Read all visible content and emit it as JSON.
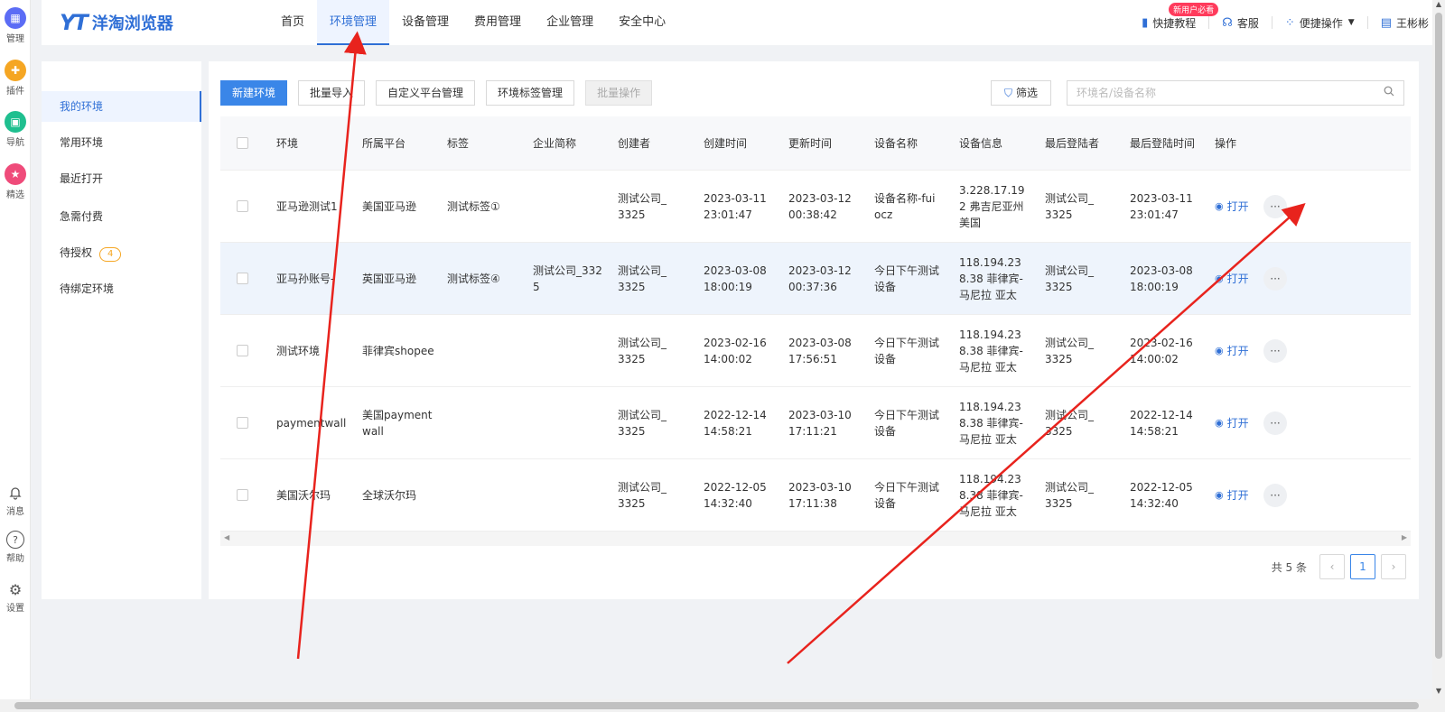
{
  "rail": {
    "top": [
      {
        "icon": "manage-icon",
        "label": "管理",
        "color": "#5b6cf5"
      },
      {
        "icon": "plugin-icon",
        "label": "插件",
        "color": "#f5a623"
      },
      {
        "icon": "nav-icon",
        "label": "导航",
        "color": "#1fbf8f"
      },
      {
        "icon": "featured-icon",
        "label": "精选",
        "color": "#ef4b7a"
      }
    ],
    "bottom": [
      {
        "icon": "bell-icon",
        "label": "消息",
        "glyph": "🔔"
      },
      {
        "icon": "help-icon",
        "label": "帮助",
        "glyph": "?"
      },
      {
        "icon": "settings-icon",
        "label": "设置",
        "glyph": "⚙"
      }
    ]
  },
  "header": {
    "logo_mark": "YT",
    "logo_text": "洋淘浏览器",
    "nav": [
      "首页",
      "环境管理",
      "设备管理",
      "费用管理",
      "企业管理",
      "安全中心"
    ],
    "active_nav": 1,
    "tutorial": "快捷教程",
    "new_badge": "新用户必看",
    "service": "客服",
    "quick_ops": "便捷操作",
    "user": "王彬彬"
  },
  "side": {
    "items": [
      "我的环境",
      "常用环境",
      "最近打开",
      "急需付费",
      "待授权",
      "待绑定环境"
    ],
    "pending_count": "4"
  },
  "toolbar": {
    "new_env": "新建环境",
    "batch_import": "批量导入",
    "custom_platform": "自定义平台管理",
    "tag_manage": "环境标签管理",
    "batch_ops": "批量操作",
    "filter": "筛选",
    "search_placeholder": "环境名/设备名称"
  },
  "table": {
    "headers": [
      "环境",
      "所属平台",
      "标签",
      "企业简称",
      "创建者",
      "创建时间",
      "更新时间",
      "设备名称",
      "设备信息",
      "最后登陆者",
      "最后登陆时间",
      "操作"
    ],
    "open_label": "打开",
    "rows": [
      {
        "env": "亚马逊测试1",
        "platform": "美国亚马逊",
        "tag": "测试标签①",
        "company": "",
        "creator": "测试公司_3325",
        "created": "2023-03-11 23:01:47",
        "updated": "2023-03-12 00:38:42",
        "device": "设备名称-fuiocz",
        "device_info": "3.228.17.192 弗吉尼亚州 美国",
        "last_user": "测试公司_3325",
        "last_login": "2023-03-11 23:01:47"
      },
      {
        "env": "亚马孙账号-",
        "platform": "英国亚马逊",
        "tag": "测试标签④",
        "company": "测试公司_3325",
        "creator": "测试公司_3325",
        "created": "2023-03-08 18:00:19",
        "updated": "2023-03-12 00:37:36",
        "device": "今日下午测试设备",
        "device_info": "118.194.238.38 菲律宾-马尼拉 亚太",
        "last_user": "测试公司_3325",
        "last_login": "2023-03-08 18:00:19"
      },
      {
        "env": "测试环境",
        "platform": "菲律宾shopee",
        "tag": "",
        "company": "",
        "creator": "测试公司_3325",
        "created": "2023-02-16 14:00:02",
        "updated": "2023-03-08 17:56:51",
        "device": "今日下午测试设备",
        "device_info": "118.194.238.38 菲律宾-马尼拉 亚太",
        "last_user": "测试公司_3325",
        "last_login": "2023-02-16 14:00:02"
      },
      {
        "env": "paymentwall",
        "platform": "美国paymentwall",
        "tag": "",
        "company": "",
        "creator": "测试公司_3325",
        "created": "2022-12-14 14:58:21",
        "updated": "2023-03-10 17:11:21",
        "device": "今日下午测试设备",
        "device_info": "118.194.238.38 菲律宾-马尼拉 亚太",
        "last_user": "测试公司_3325",
        "last_login": "2022-12-14 14:58:21"
      },
      {
        "env": "美国沃尔玛",
        "platform": "全球沃尔玛",
        "tag": "",
        "company": "",
        "creator": "测试公司_3325",
        "created": "2022-12-05 14:32:40",
        "updated": "2023-03-10 17:11:38",
        "device": "今日下午测试设备",
        "device_info": "118.194.238.38 菲律宾-马尼拉 亚太",
        "last_user": "测试公司_3325",
        "last_login": "2022-12-05 14:32:40"
      }
    ]
  },
  "pager": {
    "total": "共 5 条",
    "current": "1"
  },
  "colors": {
    "accent": "#2f6fd6",
    "arrow": "#e8231d"
  }
}
